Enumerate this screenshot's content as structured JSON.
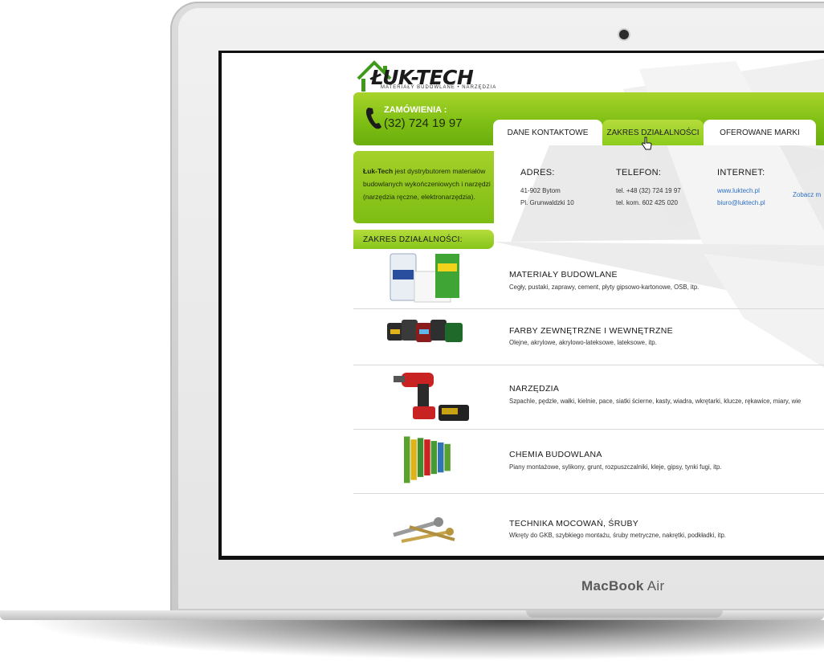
{
  "device": {
    "brand_light": "MacBook",
    "brand_model": "Air"
  },
  "site": {
    "logo": {
      "name": "ŁUK-TECH",
      "tagline": "MATERIAŁY BUDOWLANE • NARZĘDZIA"
    },
    "order": {
      "label": "ZAMÓWIENIA :",
      "phone": "(32) 724 19 97"
    },
    "tabs": [
      {
        "label": "DANE KONTAKTOWE"
      },
      {
        "label": "ZAKRES DZIAŁALNOŚCI"
      },
      {
        "label": "OFEROWANE MARKI"
      }
    ],
    "intro": {
      "brand": "Łuk-Tech",
      "text": " jest dystrybutorem materiałów budowlanych wykończeniowych i narzędzi (narzędzia ręczne, elektronarzędzia)."
    },
    "contact": {
      "address": {
        "label": "ADRES:",
        "line1": "41-902 Bytom",
        "line2": "Pl. Grunwaldzki 10"
      },
      "phone": {
        "label": "TELEFON:",
        "line1": "tel. +48 (32) 724 19 97",
        "line2": "tel. kom. 602 425 020"
      },
      "internet": {
        "label": "INTERNET:",
        "line1": "www.luktech.pl",
        "line2": "biuro@luktech.pl"
      },
      "more_link": "Zobacz m"
    },
    "section_title": "ZAKRES DZIAŁALNOŚCI:",
    "categories": [
      {
        "title": "MATERIAŁY BUDOWLANE",
        "desc": "Cegły, pustaki, zaprawy, cement, płyty gipsowo-kartonowe, OSB, itp."
      },
      {
        "title": "FARBY ZEWNĘTRZNE I WEWNĘTRZNE",
        "desc": "Olejne, akrylowe, akrylowo-lateksowe, lateksowe, itp."
      },
      {
        "title": "NARZĘDZIA",
        "desc": "Szpachle, pędzle, wałki, kielnie, pace, siatki ścierne, kasty, wiadra, wkrętarki, klucze, rękawice, miary, wie"
      },
      {
        "title": "CHEMIA BUDOWLANA",
        "desc": "Piany montażowe, sylikony, grunt, rozpuszczalniki, kleje, gipsy, tynki fugi, itp."
      },
      {
        "title": "TECHNIKA MOCOWAŃ, ŚRUBY",
        "desc": "Wkręty do GKB, szybkiego montażu, śruby metryczne, nakrętki, podkładki, itp."
      }
    ]
  },
  "colors": {
    "brand_green": "#8cc61d",
    "link_blue": "#2c6fc4"
  }
}
